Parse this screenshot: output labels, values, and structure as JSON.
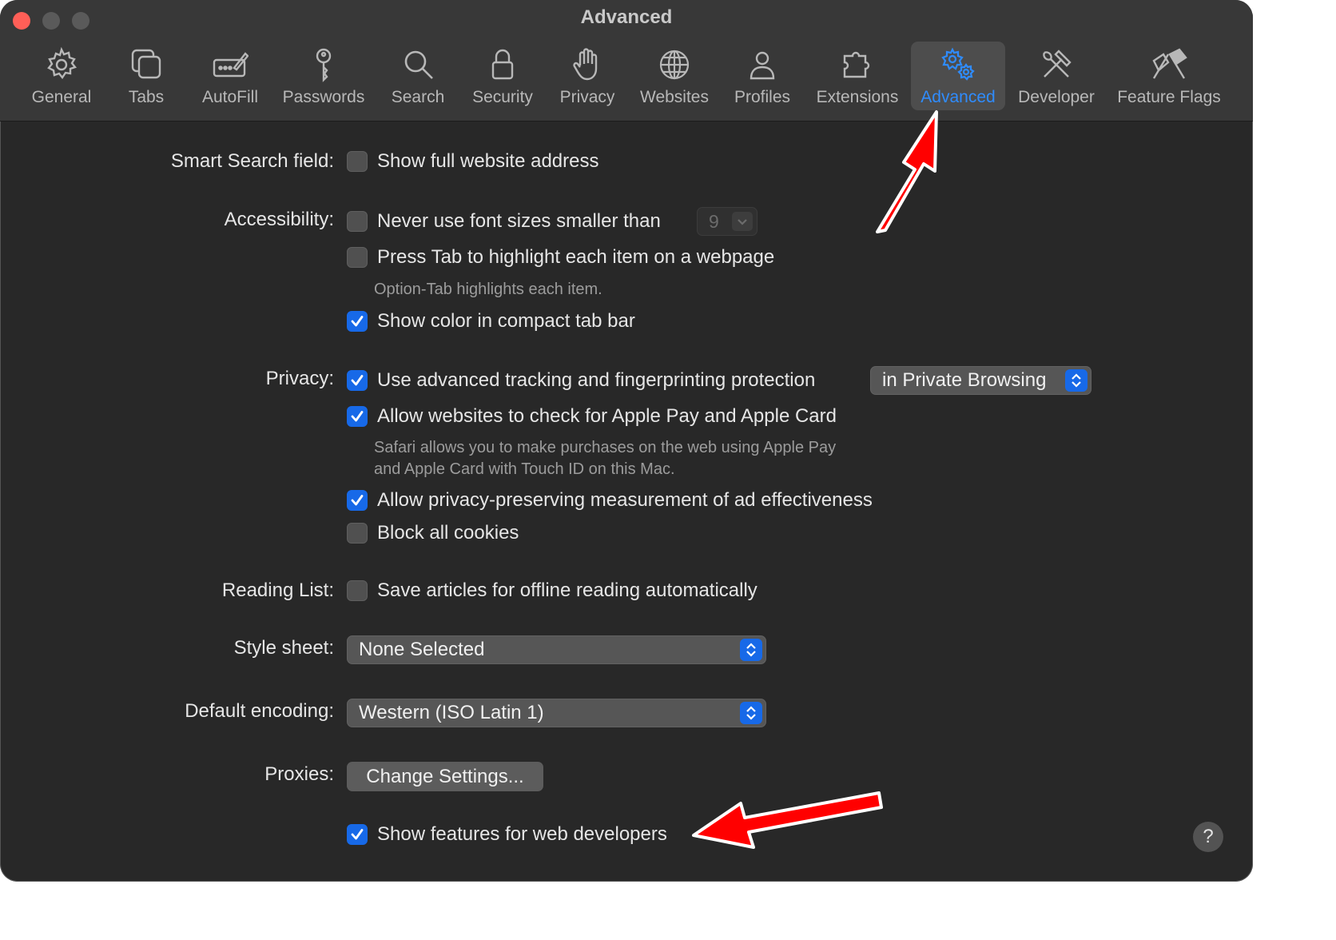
{
  "window": {
    "title": "Advanced"
  },
  "toolbar": {
    "items": [
      {
        "label": "General",
        "icon": "gear-icon"
      },
      {
        "label": "Tabs",
        "icon": "tabs-icon"
      },
      {
        "label": "AutoFill",
        "icon": "autofill-icon"
      },
      {
        "label": "Passwords",
        "icon": "key-icon"
      },
      {
        "label": "Search",
        "icon": "search-icon"
      },
      {
        "label": "Security",
        "icon": "lock-icon"
      },
      {
        "label": "Privacy",
        "icon": "hand-icon"
      },
      {
        "label": "Websites",
        "icon": "globe-icon"
      },
      {
        "label": "Profiles",
        "icon": "person-icon"
      },
      {
        "label": "Extensions",
        "icon": "puzzle-icon"
      },
      {
        "label": "Advanced",
        "icon": "gears-icon",
        "selected": true
      },
      {
        "label": "Developer",
        "icon": "tools-icon"
      },
      {
        "label": "Feature Flags",
        "icon": "flags-icon"
      }
    ]
  },
  "settings": {
    "smart_search": {
      "label": "Smart Search field:",
      "option": "Show full website address",
      "checked": false
    },
    "accessibility": {
      "label": "Accessibility:",
      "min_font": {
        "option": "Never use font sizes smaller than",
        "checked": false,
        "value": "9"
      },
      "press_tab": {
        "option": "Press Tab to highlight each item on a webpage",
        "checked": false,
        "note": "Option-Tab highlights each item."
      },
      "compact_color": {
        "option": "Show color in compact tab bar",
        "checked": true
      }
    },
    "privacy": {
      "label": "Privacy:",
      "tracking": {
        "option": "Use advanced tracking and fingerprinting protection",
        "checked": true,
        "popup": "in Private Browsing"
      },
      "apple_pay": {
        "option": "Allow websites to check for Apple Pay and Apple Card",
        "checked": true,
        "note_line1": "Safari allows you to make purchases on the web using Apple Pay",
        "note_line2": "and Apple Card with Touch ID on this Mac."
      },
      "ad_measurement": {
        "option": "Allow privacy-preserving measurement of ad effectiveness",
        "checked": true
      },
      "block_cookies": {
        "option": "Block all cookies",
        "checked": false
      }
    },
    "reading_list": {
      "label": "Reading List:",
      "option": "Save articles for offline reading automatically",
      "checked": false
    },
    "style_sheet": {
      "label": "Style sheet:",
      "value": "None Selected"
    },
    "encoding": {
      "label": "Default encoding:",
      "value": "Western (ISO Latin 1)"
    },
    "proxies": {
      "label": "Proxies:",
      "button": "Change Settings..."
    },
    "web_developers": {
      "option": "Show features for web developers",
      "checked": true
    }
  },
  "help": {
    "label": "?"
  },
  "colors": {
    "accent": "#1769e8",
    "selected_tab": "#2f8cff",
    "annotation_arrow": "#ff0000"
  }
}
